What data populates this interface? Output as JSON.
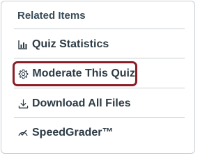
{
  "panel": {
    "heading": "Related Items",
    "items": [
      {
        "label": "Quiz Statistics",
        "icon": "statistics-icon"
      },
      {
        "label": "Moderate This Quiz",
        "icon": "gear-icon",
        "highlighted": true
      },
      {
        "label": "Download All Files",
        "icon": "download-icon"
      },
      {
        "label": "SpeedGrader™",
        "icon": "speedgrader-icon"
      }
    ]
  },
  "colors": {
    "highlight_border": "#8b1d26",
    "text": "#2d3b45",
    "divider": "#c7cdd1"
  }
}
